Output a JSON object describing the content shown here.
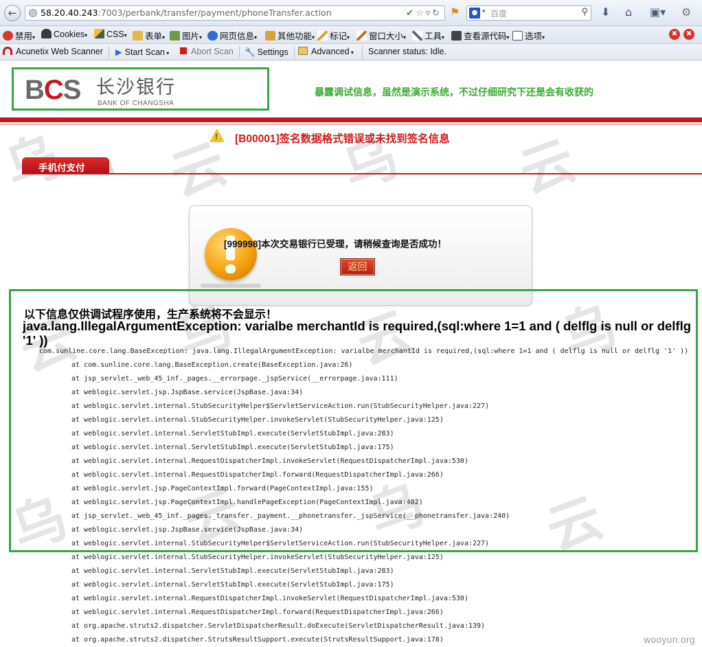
{
  "browser": {
    "url_host": "58.20.40.243",
    "url_path": ":7003/perbank/transfer/payment/phoneTransfer.action",
    "search_placeholder": "百度",
    "toolbar": [
      "禁用",
      "Cookies",
      "CSS",
      "表单",
      "图片",
      "网页信息",
      "其他功能",
      "标记",
      "窗口大小",
      "工具",
      "查看源代码",
      "选项"
    ]
  },
  "scanner_bar": {
    "product": "Acunetix Web Scanner",
    "start": "Start Scan",
    "abort": "Abort Scan",
    "settings": "Settings",
    "advanced": "Advanced",
    "status": "Scanner status: Idle."
  },
  "page": {
    "logo_mark_b": "B",
    "logo_mark_c": "C",
    "logo_mark_s": "S",
    "logo_cn": "长沙银行",
    "logo_en": "BANK OF CHANGSHA",
    "slogan": "暴露调试信息，虽然是演示系统，不过仔细研究下还是会有收获的",
    "error": "[B00001]签名数据格式错误或未找到签名信息",
    "tab": "手机付支付",
    "message": "[999998]本次交易银行已受理，请稍候查询是否成功！",
    "back": "返回",
    "debug_title": "以下信息仅供调试程序使用，生产系统将不会显示！",
    "exception": "java.lang.IllegalArgumentException: varialbe merchantId is required,(sql:where 1=1 and ( delflg is null or delflg '1' ))",
    "stack_first": "com.sunline.core.lang.BaseException: java.lang.IllegalArgumentException: varialbe merchantId is required,(sql:where 1=1 and ( delflg is null or delflg '1' ))",
    "stack": [
      "at com.sunline.core.lang.BaseException.create(BaseException.java:26)",
      "at jsp_servlet._web_45_inf._pages.__errorpage._jspService(__errorpage.java:111)",
      "at weblogic.servlet.jsp.JspBase.service(JspBase.java:34)",
      "at weblogic.servlet.internal.StubSecurityHelper$ServletServiceAction.run(StubSecurityHelper.java:227)",
      "at weblogic.servlet.internal.StubSecurityHelper.invokeServlet(StubSecurityHelper.java:125)",
      "at weblogic.servlet.internal.ServletStubImpl.execute(ServletStubImpl.java:283)",
      "at weblogic.servlet.internal.ServletStubImpl.execute(ServletStubImpl.java:175)",
      "at weblogic.servlet.internal.RequestDispatcherImpl.invokeServlet(RequestDispatcherImpl.java:530)",
      "at weblogic.servlet.internal.RequestDispatcherImpl.forward(RequestDispatcherImpl.java:266)",
      "at weblogic.servlet.jsp.PageContextImpl.forward(PageContextImpl.java:155)",
      "at weblogic.servlet.jsp.PageContextImpl.handlePageException(PageContextImpl.java:402)",
      "at jsp_servlet._web_45_inf._pages._transfer._payment.__phonetransfer._jspService(__phonetransfer.java:240)",
      "at weblogic.servlet.jsp.JspBase.service(JspBase.java:34)",
      "at weblogic.servlet.internal.StubSecurityHelper$ServletServiceAction.run(StubSecurityHelper.java:227)",
      "at weblogic.servlet.internal.StubSecurityHelper.invokeServlet(StubSecurityHelper.java:125)",
      "at weblogic.servlet.internal.ServletStubImpl.execute(ServletStubImpl.java:283)",
      "at weblogic.servlet.internal.ServletStubImpl.execute(ServletStubImpl.java:175)",
      "at weblogic.servlet.internal.RequestDispatcherImpl.invokeServlet(RequestDispatcherImpl.java:530)",
      "at weblogic.servlet.internal.RequestDispatcherImpl.forward(RequestDispatcherImpl.java:266)",
      "at org.apache.struts2.dispatcher.ServletDispatcherResult.doExecute(ServletDispatcherResult.java:139)",
      "at org.apache.struts2.dispatcher.StrutsResultSupport.execute(StrutsResultSupport.java:178)"
    ],
    "watermark": "wooyun.org"
  },
  "colors": {
    "bank_red": "#c8161d",
    "highlight_green": "#33a845",
    "slogan_green": "#3aaa35",
    "error_red": "#d21a1a"
  }
}
